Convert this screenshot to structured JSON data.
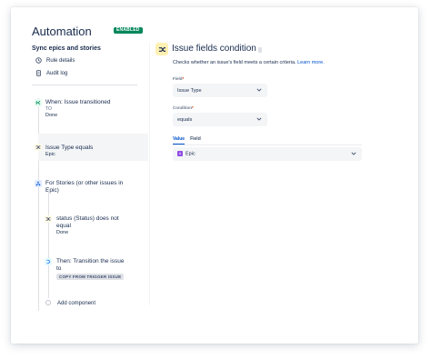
{
  "header": {
    "title": "Automation",
    "status_badge": "ENABLED",
    "rule_name": "Sync epics and stories"
  },
  "nav": [
    {
      "label": "Rule details",
      "icon": "clock-icon"
    },
    {
      "label": "Audit log",
      "icon": "document-icon"
    }
  ],
  "steps": {
    "trigger": {
      "label": "When: Issue transitioned",
      "sub_label": "TO",
      "sub_value": "Done"
    },
    "condition": {
      "label": "Issue Type equals",
      "sub_value": "Epic"
    },
    "branch": {
      "label_line1": "For Stories (or other issues in",
      "label_line2": "Epic)"
    },
    "branch_condition": {
      "label_line1": "status (Status) does not",
      "label_line2": "equal",
      "sub_value": "Done"
    },
    "action": {
      "label_line1": "Then: Transition the issue",
      "label_line2": "to",
      "tag": "COPY FROM TRIGGER ISSUE"
    },
    "add_component": "Add component"
  },
  "panel": {
    "title": "Issue fields condition",
    "description": "Checks whether an issue's field meets a certain criteria.",
    "learn_more": "Learn more.",
    "field_label": "Field",
    "field_value": "Issue Type",
    "condition_label": "Condition",
    "condition_value": "equals",
    "tabs": [
      "Value",
      "Field"
    ],
    "value_selected": "Epic"
  },
  "colors": {
    "accent": "#0052cc",
    "enabled": "#00875a",
    "epic": "#904ee2",
    "required": "#de350b"
  }
}
